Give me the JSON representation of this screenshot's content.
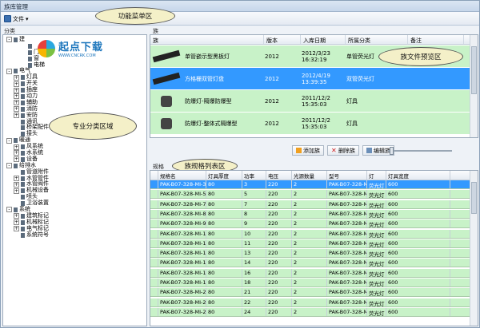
{
  "window": {
    "title": "族库管理"
  },
  "menu": {
    "file": "文件"
  },
  "callouts": {
    "menu_area": "功能菜单区",
    "category_area": "专业分类区域",
    "family_preview": "族文件预览区",
    "spec_list": "族规格列表区"
  },
  "left": {
    "title": "分类"
  },
  "logo": {
    "main": "起点下载",
    "sub": "WWW.CNCRK.COM"
  },
  "tree": [
    {
      "indent": 0,
      "exp": "-",
      "label": "建"
    },
    {
      "indent": 2,
      "exp": "",
      "label": ""
    },
    {
      "indent": 2,
      "exp": "",
      "label": "门"
    },
    {
      "indent": 2,
      "exp": "",
      "label": "窗"
    },
    {
      "indent": 2,
      "exp": "",
      "label": "电梯"
    },
    {
      "indent": 0,
      "exp": "-",
      "label": "电气"
    },
    {
      "indent": 1,
      "exp": "+",
      "label": "灯具"
    },
    {
      "indent": 1,
      "exp": "+",
      "label": "开关"
    },
    {
      "indent": 1,
      "exp": "+",
      "label": "插座"
    },
    {
      "indent": 1,
      "exp": "+",
      "label": "动力"
    },
    {
      "indent": 1,
      "exp": "+",
      "label": "辅助"
    },
    {
      "indent": 1,
      "exp": "+",
      "label": "消防"
    },
    {
      "indent": 1,
      "exp": "+",
      "label": "安防"
    },
    {
      "indent": 1,
      "exp": "",
      "label": "通讯"
    },
    {
      "indent": 1,
      "exp": "",
      "label": "桥架配件"
    },
    {
      "indent": 1,
      "exp": "",
      "label": "接头"
    },
    {
      "indent": 0,
      "exp": "-",
      "label": "暖通"
    },
    {
      "indent": 1,
      "exp": "+",
      "label": "风系统"
    },
    {
      "indent": 1,
      "exp": "+",
      "label": "水系统"
    },
    {
      "indent": 1,
      "exp": "+",
      "label": "设备"
    },
    {
      "indent": 0,
      "exp": "-",
      "label": "给排水"
    },
    {
      "indent": 1,
      "exp": "",
      "label": "管道附件"
    },
    {
      "indent": 1,
      "exp": "+",
      "label": "水管管件"
    },
    {
      "indent": 1,
      "exp": "+",
      "label": "水管阀件"
    },
    {
      "indent": 1,
      "exp": "+",
      "label": "机械设备"
    },
    {
      "indent": 1,
      "exp": "",
      "label": "喷头"
    },
    {
      "indent": 1,
      "exp": "",
      "label": "卫浴装置"
    },
    {
      "indent": 0,
      "exp": "-",
      "label": "系统"
    },
    {
      "indent": 1,
      "exp": "+",
      "label": "建筑标记"
    },
    {
      "indent": 1,
      "exp": "+",
      "label": "机械标记"
    },
    {
      "indent": 1,
      "exp": "+",
      "label": "电气标记"
    },
    {
      "indent": 1,
      "exp": "",
      "label": "系统符号"
    }
  ],
  "family_panel": {
    "title": "族",
    "headers": [
      "族",
      "版本",
      "入库日期",
      "所属分类",
      "备注"
    ],
    "rows": [
      {
        "name": "单管嵌示型黑板灯",
        "version": "2012",
        "date": "2012/3/23 16:32:19",
        "category": "单管荧光灯",
        "note": ""
      },
      {
        "name": "方格栅双管灯盘",
        "version": "2012",
        "date": "2012/4/19 13:39:35",
        "category": "双管荧光灯",
        "note": ""
      },
      {
        "name": "防爆灯-隔爆防爆型",
        "version": "2012",
        "date": "2011/12/2 15:35:03",
        "category": "灯具",
        "note": ""
      },
      {
        "name": "防爆灯-整体式隔爆型",
        "version": "2012",
        "date": "2011/12/2 15:35:03",
        "category": "灯具",
        "note": ""
      }
    ]
  },
  "family_toolbar": {
    "add": "添加族",
    "delete": "删除族",
    "edit": "编辑族"
  },
  "spec_panel": {
    "title": "规格",
    "headers": [
      "",
      "规格名",
      "灯具厚度",
      "功率",
      "电压",
      "光源数量",
      "型号",
      "灯",
      "灯具宽度"
    ],
    "rows": [
      [
        "",
        "PAK-B07-328-MI-3W",
        "80",
        "3",
        "220",
        "2",
        "PAK-B07-328-MI",
        "荧光灯",
        "600"
      ],
      [
        "",
        "PAK-B07-328-MI-5W",
        "80",
        "5",
        "220",
        "2",
        "PAK-B07-328-MI",
        "荧光灯",
        "600"
      ],
      [
        "",
        "PAK-B07-328-MI-7W",
        "80",
        "7",
        "220",
        "2",
        "PAK-B07-328-MI",
        "荧光灯",
        "600"
      ],
      [
        "",
        "PAK-B07-328-MI-8W",
        "80",
        "8",
        "220",
        "2",
        "PAK-B07-328-MI",
        "荧光灯",
        "600"
      ],
      [
        "",
        "PAK-B07-328-MI-9W",
        "80",
        "9",
        "220",
        "2",
        "PAK-B07-328-MI",
        "荧光灯",
        "600"
      ],
      [
        "",
        "PAK-B07-328-MI-10W",
        "80",
        "10",
        "220",
        "2",
        "PAK-B07-328-MI",
        "荧光灯",
        "600"
      ],
      [
        "",
        "PAK-B07-328-MI-11W",
        "80",
        "11",
        "220",
        "2",
        "PAK-B07-328-MI",
        "荧光灯",
        "600"
      ],
      [
        "",
        "PAK-B07-328-MI-13W",
        "80",
        "13",
        "220",
        "2",
        "PAK-B07-328-MI",
        "荧光灯",
        "600"
      ],
      [
        "",
        "PAK-B07-328-MI-14W",
        "80",
        "14",
        "220",
        "2",
        "PAK-B07-328-MI",
        "荧光灯",
        "600"
      ],
      [
        "",
        "PAK-B07-328-MI-16W",
        "80",
        "16",
        "220",
        "2",
        "PAK-B07-328-MI",
        "荧光灯",
        "600"
      ],
      [
        "",
        "PAK-B07-328-MI-18W",
        "80",
        "18",
        "220",
        "2",
        "PAK-B07-328-MI",
        "荧光灯",
        "600"
      ],
      [
        "",
        "PAK-B07-328-MI-21W",
        "80",
        "21",
        "220",
        "2",
        "PAK-B07-328-MI",
        "荧光灯",
        "600"
      ],
      [
        "",
        "PAK-B07-328-MI-22W",
        "80",
        "22",
        "220",
        "2",
        "PAK-B07-328-MI",
        "荧光灯",
        "600"
      ],
      [
        "",
        "PAK-B07-328-MI-24W",
        "80",
        "24",
        "220",
        "2",
        "PAK-B07-328-MI",
        "荧光灯",
        "600"
      ]
    ]
  }
}
